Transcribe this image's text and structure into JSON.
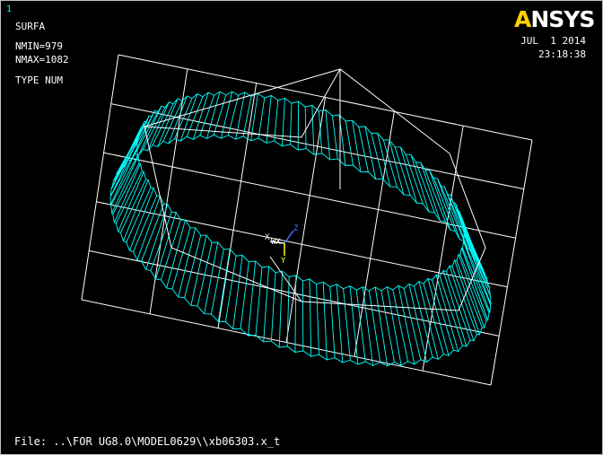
{
  "window": {
    "number": "1"
  },
  "legend": {
    "entity": "SURFA",
    "nmin": "NMIN=979",
    "nmax": "NMAX=1082",
    "type": "TYPE NUM"
  },
  "logo": {
    "prefix": "",
    "a_letter": "A",
    "rest": "NSYS"
  },
  "timestamp": {
    "date": "JUL  1 2014",
    "time": "23:18:38"
  },
  "triad": {
    "x_label": "X",
    "wx_label": "WX",
    "y_label": "Y",
    "z_label": "Z"
  },
  "file": {
    "path": "File: ..\\FOR UG8.0\\MODEL0629\\\\xb06303.x_t"
  },
  "colors": {
    "background": "#000000",
    "grid": "#ffffff",
    "mesh": "#00ffff",
    "text": "#ffffff",
    "triad_x": "#ffffff",
    "triad_y": "#ffff00",
    "triad_z": "#3c78ff"
  }
}
